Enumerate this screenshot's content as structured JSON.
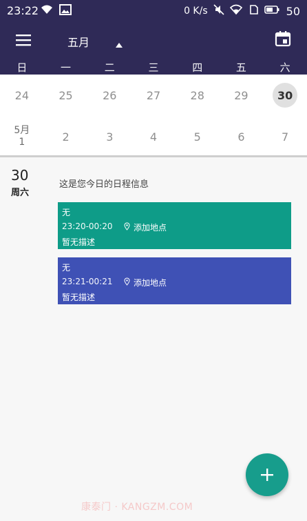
{
  "status_bar": {
    "time": "23:22",
    "net_speed": "0 K/s",
    "battery": "50"
  },
  "toolbar": {
    "month": "五月"
  },
  "weekdays": [
    "日",
    "一",
    "二",
    "三",
    "四",
    "五",
    "六"
  ],
  "calendar": {
    "row1": [
      "24",
      "25",
      "26",
      "27",
      "28",
      "29",
      "30"
    ],
    "row2": {
      "first_month": "5月",
      "first_day": "1",
      "days": [
        "2",
        "3",
        "4",
        "5",
        "6",
        "7"
      ]
    }
  },
  "selected_day": {
    "date": "30",
    "weekday": "周六",
    "intro": "这是您今日的日程信息"
  },
  "events": [
    {
      "title": "无",
      "time": "23:20-00:20",
      "location": "添加地点",
      "description": "暂无描述",
      "color": "#0e9c88"
    },
    {
      "title": "无",
      "time": "23:21-00:21",
      "location": "添加地点",
      "description": "暂无描述",
      "color": "#3f51b5"
    }
  ],
  "colors": {
    "header": "#2f2a57",
    "fab": "#179d8c"
  },
  "fab": {
    "icon": "plus-icon"
  },
  "watermark": "康泰门 · KANGZM.COM"
}
